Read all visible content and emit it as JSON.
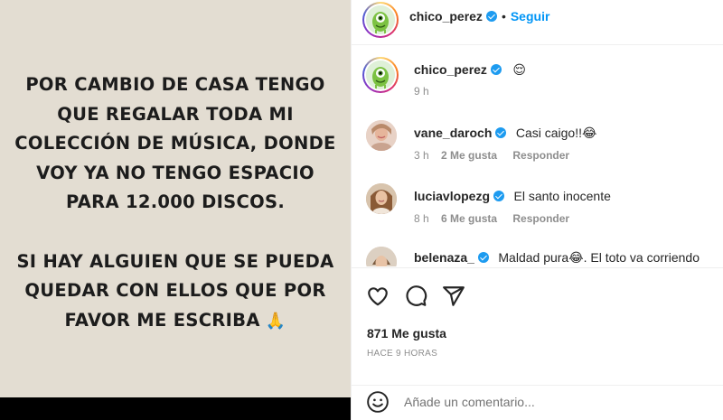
{
  "post_image": {
    "lines_block1": [
      "POR CAMBIO DE CASA TENGO",
      "QUE REGALAR TODA MI",
      "COLECCIÓN DE MÚSICA, DONDE",
      "VOY YA NO TENGO ESPACIO",
      "PARA 12.000 DISCOS."
    ],
    "lines_block2": [
      "SI HAY ALGUIEN QUE SE PUEDA",
      "QUEDAR CON ELLOS QUE POR",
      "FAVOR ME ESCRIBA"
    ],
    "emoji": "🙏",
    "background_color": "#e3ddd2"
  },
  "header": {
    "username": "chico_perez",
    "separator": "•",
    "follow_label": "Seguir"
  },
  "caption": {
    "username": "chico_perez",
    "text": "😌",
    "time": "9 h"
  },
  "comments": [
    {
      "username": "vane_daroch",
      "verified": true,
      "text": "Casi caigo!!😂",
      "time": "3 h",
      "likes": "2 Me gusta",
      "reply": "Responder"
    },
    {
      "username": "luciavlopezg",
      "verified": true,
      "text": "El santo inocente",
      "time": "8 h",
      "likes": "6 Me gusta",
      "reply": "Responder"
    },
    {
      "username": "belenaza_",
      "verified": true,
      "text": "Maldad pura😂. El toto va corriendo",
      "time": "",
      "likes": "",
      "reply": ""
    }
  ],
  "actions": {
    "icons": [
      "heart-icon",
      "comment-icon",
      "share-icon"
    ],
    "likes": "871 Me gusta",
    "timestamp": "HACE 9 HORAS"
  },
  "add_comment": {
    "placeholder": "Añade un comentario...",
    "icon": "emoji-icon"
  },
  "colors": {
    "accent": "#0095f6",
    "verified": "#1d9bf0",
    "muted": "#8e8e8e",
    "text": "#262626"
  }
}
